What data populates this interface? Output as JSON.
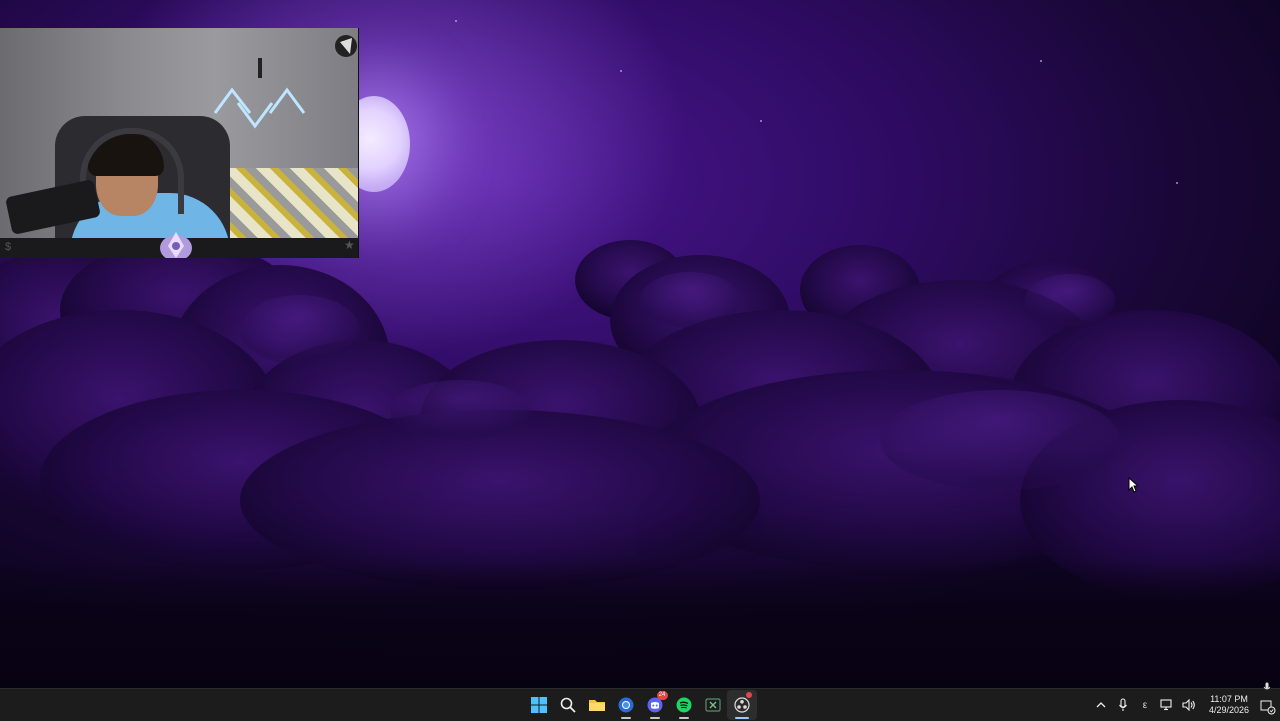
{
  "desktop": {
    "wallpaper": "purple night sky with full moon and clouds",
    "accent_color": "#2e0b62"
  },
  "webcam": {
    "badge_icon": "streamer-logo-icon",
    "corner_left_text": "$",
    "corner_right_icon": "star-icon"
  },
  "taskbar": {
    "apps": [
      {
        "name": "start-button",
        "icon": "windows-logo-icon"
      },
      {
        "name": "search-button",
        "icon": "search-icon"
      },
      {
        "name": "file-explorer",
        "icon": "folder-icon"
      },
      {
        "name": "chrome",
        "icon": "chrome-icon"
      },
      {
        "name": "discord",
        "icon": "discord-icon",
        "badge": "24"
      },
      {
        "name": "spotify",
        "icon": "spotify-icon"
      },
      {
        "name": "excel",
        "icon": "excel-icon"
      },
      {
        "name": "obs",
        "icon": "obs-icon"
      }
    ],
    "tray": {
      "overflow_icon": "chevron-up-icon",
      "mic_icon": "microphone-icon",
      "language": "ε",
      "network_icon": "network-icon",
      "volume_icon": "speaker-icon",
      "time": "11:07 PM",
      "date": "4/29/2026",
      "notification_icon": "notification-bell-icon"
    }
  }
}
